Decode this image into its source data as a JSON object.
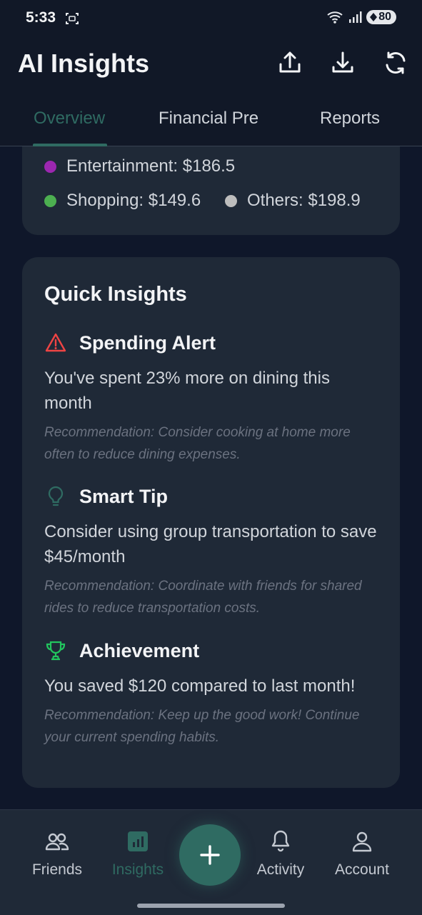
{
  "status": {
    "time": "5:33",
    "battery": "80"
  },
  "app": {
    "title": "AI Insights"
  },
  "tabs": [
    {
      "label": "Overview",
      "active": true
    },
    {
      "label": "Financial Pre",
      "active": false
    },
    {
      "label": "Reports",
      "active": false
    }
  ],
  "legend": [
    {
      "label": "Entertainment: $186.5",
      "color": "#9c27b0"
    },
    {
      "label": "Shopping: $149.6",
      "color": "#4caf50"
    },
    {
      "label": "Others: $198.9",
      "color": "#bdbdbd"
    }
  ],
  "quick_insights": {
    "title": "Quick Insights",
    "items": [
      {
        "icon": "warning-icon",
        "title": "Spending Alert",
        "message": "You've spent 23% more on dining this month",
        "recommendation": "Recommendation: Consider cooking at home more often to reduce dining expenses.",
        "color": "#ef4444"
      },
      {
        "icon": "lightbulb-icon",
        "title": "Smart Tip",
        "message": "Consider using group transportation to save $45/month",
        "recommendation": "Recommendation: Coordinate with friends for shared rides to reduce transportation costs.",
        "color": "#2f6b62"
      },
      {
        "icon": "trophy-icon",
        "title": "Achievement",
        "message": "You saved $120 compared to last month!",
        "recommendation": "Recommendation: Keep up the good work! Continue your current spending habits.",
        "color": "#22c55e"
      }
    ]
  },
  "nav": {
    "items": [
      {
        "label": "Friends",
        "icon": "friends-icon",
        "active": false
      },
      {
        "label": "Insights",
        "icon": "insights-icon",
        "active": true
      },
      {
        "label": "Activity",
        "icon": "bell-icon",
        "active": false
      },
      {
        "label": "Account",
        "icon": "account-icon",
        "active": false
      }
    ],
    "fab_icon": "plus-icon"
  },
  "colors": {
    "accent": "#2f6b62",
    "background": "#111827",
    "card": "#1f2937"
  }
}
